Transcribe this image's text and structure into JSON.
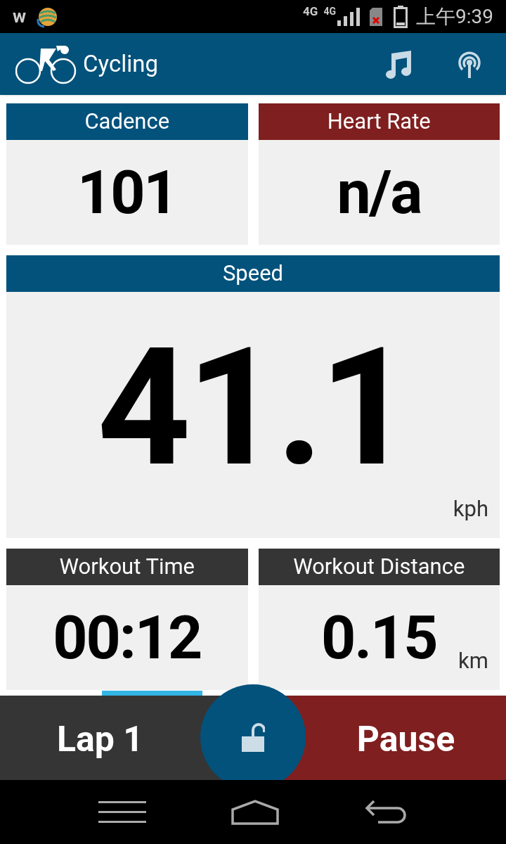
{
  "status_bar": {
    "app_letter": "w",
    "network_1": "4G",
    "network_2": "4G",
    "time": "上午9:39"
  },
  "header": {
    "title": "Cycling"
  },
  "tiles": [
    {
      "kind": "small",
      "label": "Cadence",
      "color": "#03527b",
      "value": "101"
    },
    {
      "kind": "small",
      "label": "Heart Rate",
      "color": "#801f1f",
      "value": "n/a"
    },
    {
      "kind": "large",
      "label": "Speed",
      "color": "#03527b",
      "value": "41.1",
      "unit": "kph"
    },
    {
      "kind": "small",
      "label": "Workout Time",
      "color": "#353535",
      "value": "00:12"
    },
    {
      "kind": "small",
      "label": "Workout Distance",
      "color": "#353535",
      "value": "0.15",
      "unit": "km"
    }
  ],
  "bottom_bar": {
    "lap_button": "Lap 1",
    "pause_button": "Pause",
    "locked": false
  }
}
